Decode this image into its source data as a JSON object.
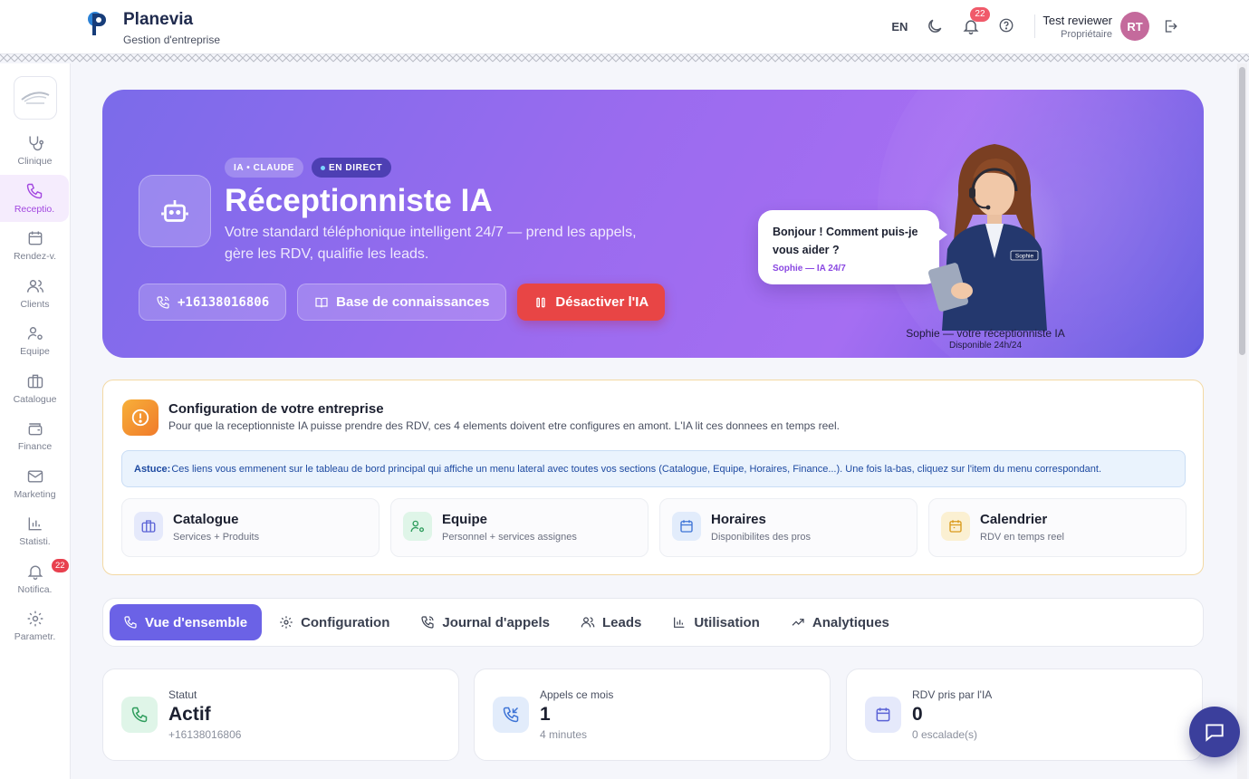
{
  "header": {
    "brand_name": "Planevia",
    "brand_sub": "Gestion d'entreprise",
    "lang": "EN",
    "notif_count": "22",
    "user_name": "Test reviewer",
    "user_role": "Propriétaire",
    "avatar_initials": "RT"
  },
  "sidebar": {
    "items": [
      {
        "label": "Clinique",
        "icon": "stethoscope-icon"
      },
      {
        "label": "Receptio.",
        "icon": "phone-icon"
      },
      {
        "label": "Rendez-v.",
        "icon": "calendar-icon"
      },
      {
        "label": "Clients",
        "icon": "users-icon"
      },
      {
        "label": "Equipe",
        "icon": "user-cog-icon"
      },
      {
        "label": "Catalogue",
        "icon": "briefcase-icon"
      },
      {
        "label": "Finance",
        "icon": "wallet-icon"
      },
      {
        "label": "Marketing",
        "icon": "mail-icon"
      },
      {
        "label": "Statisti.",
        "icon": "chart-icon"
      },
      {
        "label": "Notifica.",
        "icon": "bell-icon"
      },
      {
        "label": "Parametr.",
        "icon": "gear-icon"
      }
    ],
    "notif_badge": "22"
  },
  "hero": {
    "pill_ia": "IA • CLAUDE",
    "pill_live": "EN DIRECT",
    "title": "Réceptionniste IA",
    "subtitle": "Votre standard téléphonique intelligent 24/7 — prend les appels, gère les RDV, qualifie les leads.",
    "phone": "+16138016806",
    "kb_label": "Base de connaissances",
    "disable_label": "Désactiver l'IA",
    "speech_text": "Bonjour ! Comment puis-je vous aider ?",
    "speech_sig": "Sophie — IA 24/7",
    "badge_name": "Sophie",
    "caption_1": "Sophie — votre réceptionniste IA",
    "caption_2": "Disponible 24h/24"
  },
  "config": {
    "title": "Configuration de votre entreprise",
    "desc": "Pour que la receptionniste IA puisse prendre des RDV, ces 4 elements doivent etre configures en amont. L'IA lit ces donnees en temps reel.",
    "tip_label": "Astuce:",
    "tip_text": "Ces liens vous emmenent sur le tableau de bord principal qui affiche un menu lateral avec toutes vos sections (Catalogue, Equipe, Horaires, Finance...). Une fois la-bas, cliquez sur l'item du menu correspondant.",
    "cards": [
      {
        "title": "Catalogue",
        "sub": "Services + Produits"
      },
      {
        "title": "Equipe",
        "sub": "Personnel + services assignes"
      },
      {
        "title": "Horaires",
        "sub": "Disponibilites des pros"
      },
      {
        "title": "Calendrier",
        "sub": "RDV en temps reel"
      }
    ]
  },
  "tabs": [
    {
      "label": "Vue d'ensemble"
    },
    {
      "label": "Configuration"
    },
    {
      "label": "Journal d'appels"
    },
    {
      "label": "Leads"
    },
    {
      "label": "Utilisation"
    },
    {
      "label": "Analytiques"
    }
  ],
  "stats": [
    {
      "label": "Statut",
      "value": "Actif",
      "sub": "+16138016806"
    },
    {
      "label": "Appels ce mois",
      "value": "1",
      "sub": "4 minutes"
    },
    {
      "label": "RDV pris par l'IA",
      "value": "0",
      "sub": "0 escalade(s)"
    }
  ],
  "colors": {
    "accent": "#6b62e6",
    "hero_start": "#7b6bea",
    "hero_end": "#6058e0",
    "danger": "#e84545",
    "warning": "#f7b03a"
  }
}
